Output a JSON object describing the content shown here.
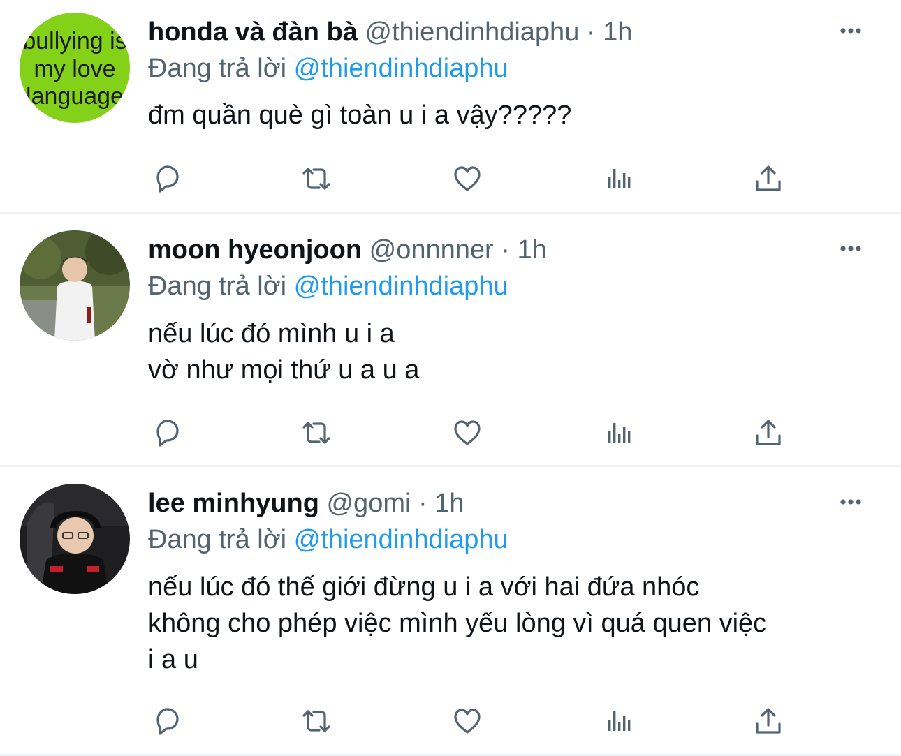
{
  "reply_prefix": "Đang trả lời",
  "tweets": [
    {
      "name": "honda và đàn bà",
      "handle": "@thiendinhdiaphu",
      "sep": "·",
      "time": "1h",
      "reply_to": "@thiendinhdiaphu",
      "lines": [
        "đm quần què gì toàn u i a vậy?????"
      ],
      "avatar_text": [
        "bullying is",
        "my love",
        "language"
      ],
      "avatar_bg": "#84d11a"
    },
    {
      "name": "moon hyeonjoon",
      "handle": "@onnnner",
      "sep": "·",
      "time": "1h",
      "reply_to": "@thiendinhdiaphu",
      "lines": [
        "nếu lúc đó mình u i a",
        "vờ như mọi thứ u a u a"
      ]
    },
    {
      "name": "lee minhyung",
      "handle": "@gomi",
      "sep": "·",
      "time": "1h",
      "reply_to": "@thiendinhdiaphu",
      "lines": [
        "nếu lúc đó thế giới đừng u i a với hai đứa nhóc",
        "không cho phép việc mình yếu lòng vì quá quen việc",
        "i a u"
      ]
    }
  ],
  "icons": [
    "reply-icon",
    "retweet-icon",
    "like-icon",
    "analytics-icon",
    "share-icon",
    "more-icon"
  ],
  "colors": {
    "accent": "#1d9bf0",
    "text": "#0f1419",
    "muted": "#536471",
    "divider": "#eff3f4"
  }
}
